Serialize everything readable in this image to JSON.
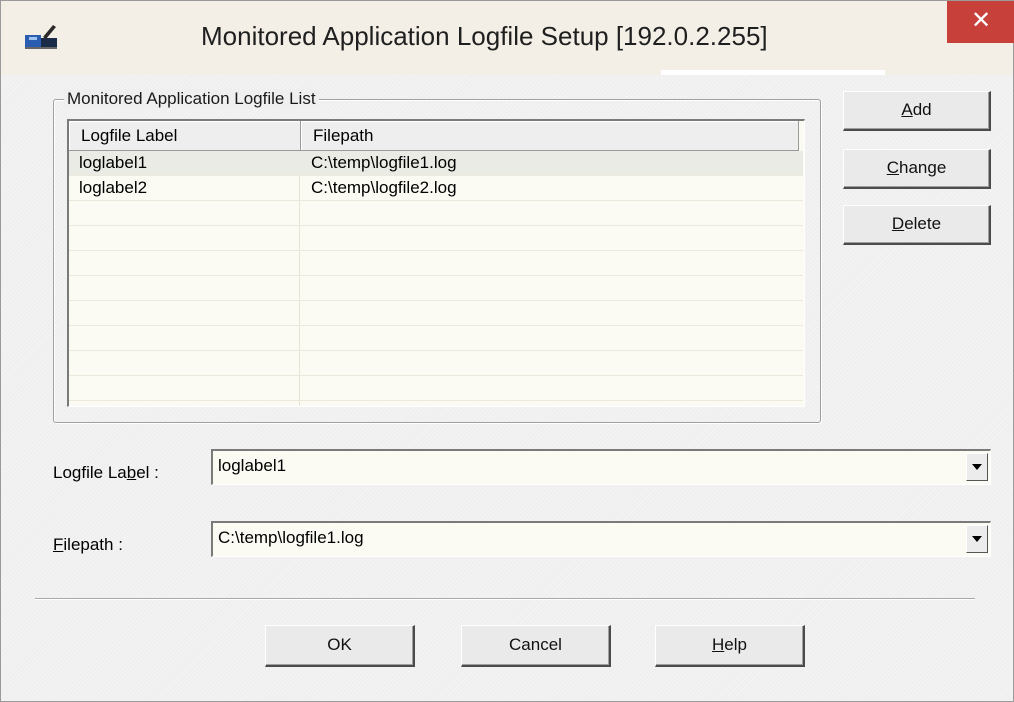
{
  "window": {
    "title": "Monitored Application Logfile Setup [192.0.2.255]",
    "close_symbol": "✕",
    "icon": "logfile-app-icon",
    "close_color": "#c7403a"
  },
  "list_group": {
    "legend": "Monitored Application Logfile List",
    "columns": [
      "Logfile Label",
      "Filepath"
    ],
    "rows": [
      {
        "label": "loglabel1",
        "path": "C:\\temp\\logfile1.log",
        "selected": true
      },
      {
        "label": "loglabel2",
        "path": "C:\\temp\\logfile2.log",
        "selected": false
      }
    ]
  },
  "side_buttons": {
    "add": {
      "mn": "A",
      "rest": "dd"
    },
    "change": {
      "mn": "C",
      "rest": "hange"
    },
    "delete": {
      "mn": "D",
      "rest": "elete"
    }
  },
  "fields": {
    "logfile_label": {
      "label_pre": "Logfile La",
      "label_mn": "b",
      "label_post": "el :",
      "value": "loglabel1"
    },
    "filepath": {
      "label_mn": "F",
      "label_post": "ilepath :",
      "value": "C:\\temp\\logfile1.log"
    }
  },
  "footer": {
    "ok": "OK",
    "cancel": "Cancel",
    "help": {
      "mn": "H",
      "rest": "elp"
    }
  }
}
